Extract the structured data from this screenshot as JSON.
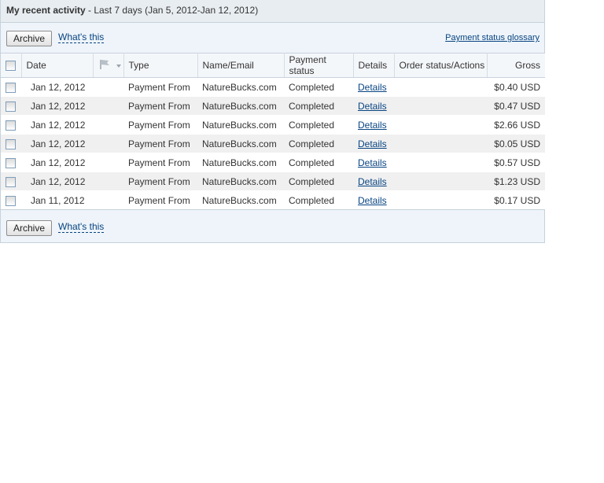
{
  "header": {
    "title": "My recent activity",
    "subtitle": " - Last 7 days (Jan 5, 2012-Jan 12, 2012)"
  },
  "toolbar": {
    "archive_label": "Archive",
    "whats_this": "What's this",
    "glossary": "Payment status glossary"
  },
  "columns": {
    "date": "Date",
    "type": "Type",
    "name": "Name/Email",
    "status": "Payment status",
    "details": "Details",
    "order": "Order status/Actions",
    "gross": "Gross"
  },
  "rows": [
    {
      "date": "Jan 12, 2012",
      "type": "Payment From",
      "name": "NatureBucks.com",
      "status": "Completed",
      "details": "Details",
      "order": "",
      "gross": "$0.40 USD"
    },
    {
      "date": "Jan 12, 2012",
      "type": "Payment From",
      "name": "NatureBucks.com",
      "status": "Completed",
      "details": "Details",
      "order": "",
      "gross": "$0.47 USD"
    },
    {
      "date": "Jan 12, 2012",
      "type": "Payment From",
      "name": "NatureBucks.com",
      "status": "Completed",
      "details": "Details",
      "order": "",
      "gross": "$2.66 USD"
    },
    {
      "date": "Jan 12, 2012",
      "type": "Payment From",
      "name": "NatureBucks.com",
      "status": "Completed",
      "details": "Details",
      "order": "",
      "gross": "$0.05 USD"
    },
    {
      "date": "Jan 12, 2012",
      "type": "Payment From",
      "name": "NatureBucks.com",
      "status": "Completed",
      "details": "Details",
      "order": "",
      "gross": "$0.57 USD"
    },
    {
      "date": "Jan 12, 2012",
      "type": "Payment From",
      "name": "NatureBucks.com",
      "status": "Completed",
      "details": "Details",
      "order": "",
      "gross": "$1.23 USD"
    },
    {
      "date": "Jan 11, 2012",
      "type": "Payment From",
      "name": "NatureBucks.com",
      "status": "Completed",
      "details": "Details",
      "order": "",
      "gross": "$0.17 USD"
    }
  ],
  "footer": {
    "archive_label": "Archive",
    "whats_this": "What's this"
  },
  "icons": {
    "flag": "flag-icon",
    "sort": "sort-arrow-icon"
  },
  "colors": {
    "link": "#084482",
    "header_bg": "#e8edf1",
    "panel_bg": "#eef4f9"
  }
}
